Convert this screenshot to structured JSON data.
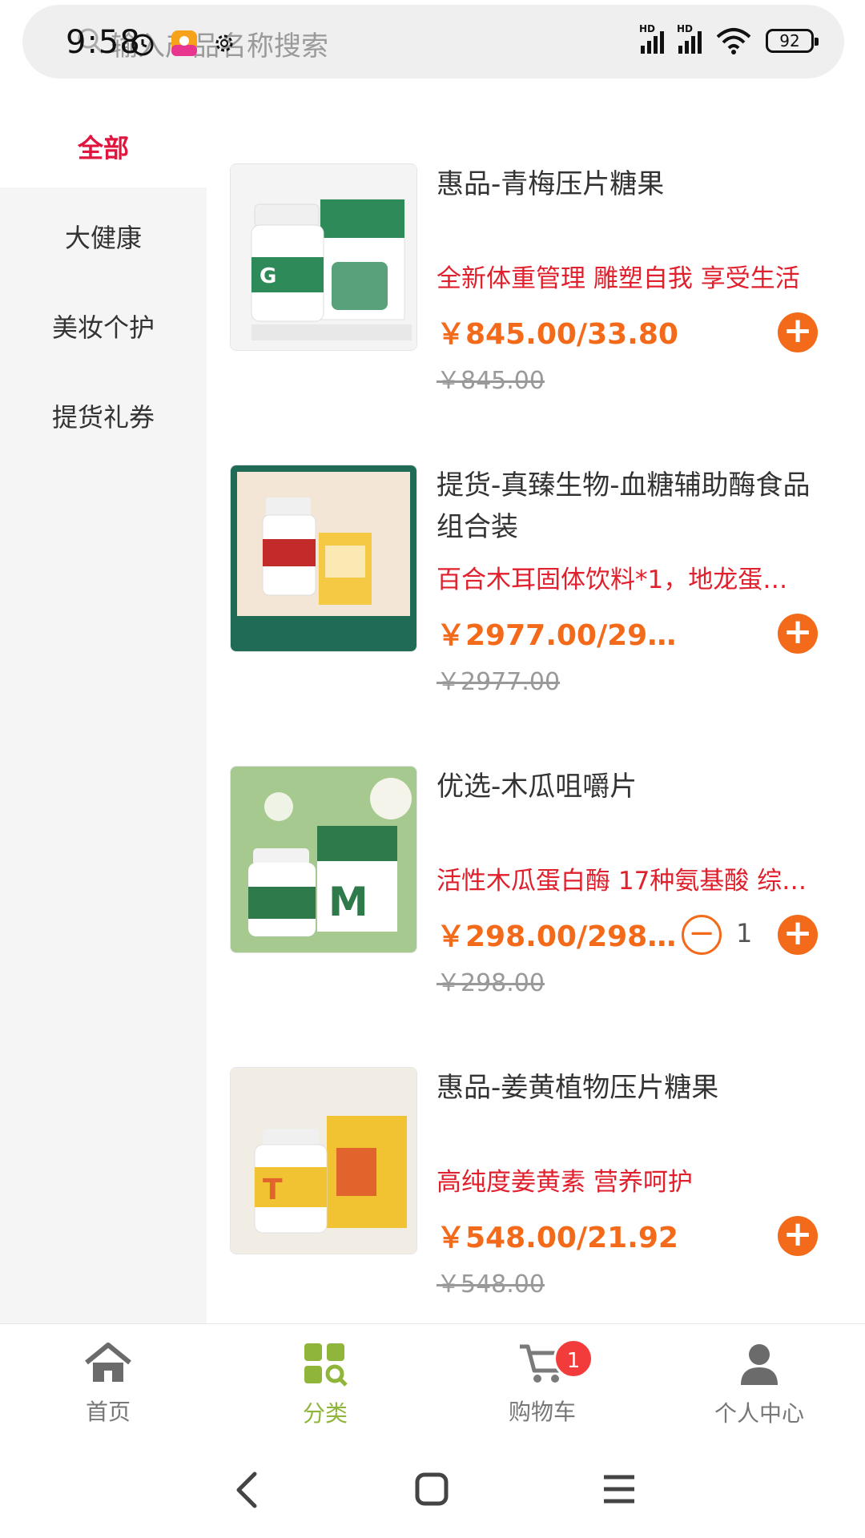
{
  "status": {
    "time": "9:58",
    "battery": "92",
    "hd1": "HD",
    "hd2": "HD"
  },
  "search": {
    "placeholder": "输入产品名称搜索"
  },
  "sidebar": {
    "items": [
      {
        "label": "全部",
        "active": true
      },
      {
        "label": "大健康"
      },
      {
        "label": "美妆个护"
      },
      {
        "label": "提货礼券"
      }
    ]
  },
  "products": [
    {
      "name": "惠品-青梅压片糖果",
      "desc": "全新体重管理 雕塑自我 享受生活",
      "price": "￥845.00/33.80",
      "orig": "￥845.00",
      "thumb_theme": "#2f8a5a"
    },
    {
      "name": "提货-真臻生物-血糖辅助酶食品组合装",
      "desc": "百合木耳固体饮料*1，地龙蛋…",
      "price": "￥2977.00/29…",
      "orig": "￥2977.00",
      "thumb_theme": "#1f6b56"
    },
    {
      "name": "优选-木瓜咀嚼片",
      "desc": "活性木瓜蛋白酶 17种氨基酸 综…",
      "price": "￥298.00/298…",
      "orig": "￥298.00",
      "qty": "1",
      "thumb_theme": "#a5c98f"
    },
    {
      "name": "惠品-姜黄植物压片糖果",
      "desc": "高纯度姜黄素 营养呵护",
      "price": "￥548.00/21.92",
      "orig": "￥548.00",
      "thumb_theme": "#f1c232"
    }
  ],
  "nav": {
    "home": "首页",
    "category": "分类",
    "cart": "购物车",
    "cart_badge": "1",
    "profile": "个人中心"
  },
  "colors": {
    "accent": "#f36a1a",
    "active_sidebar": "#e0163f",
    "nav_active": "#8fb53a",
    "desc_red": "#e0202c"
  }
}
